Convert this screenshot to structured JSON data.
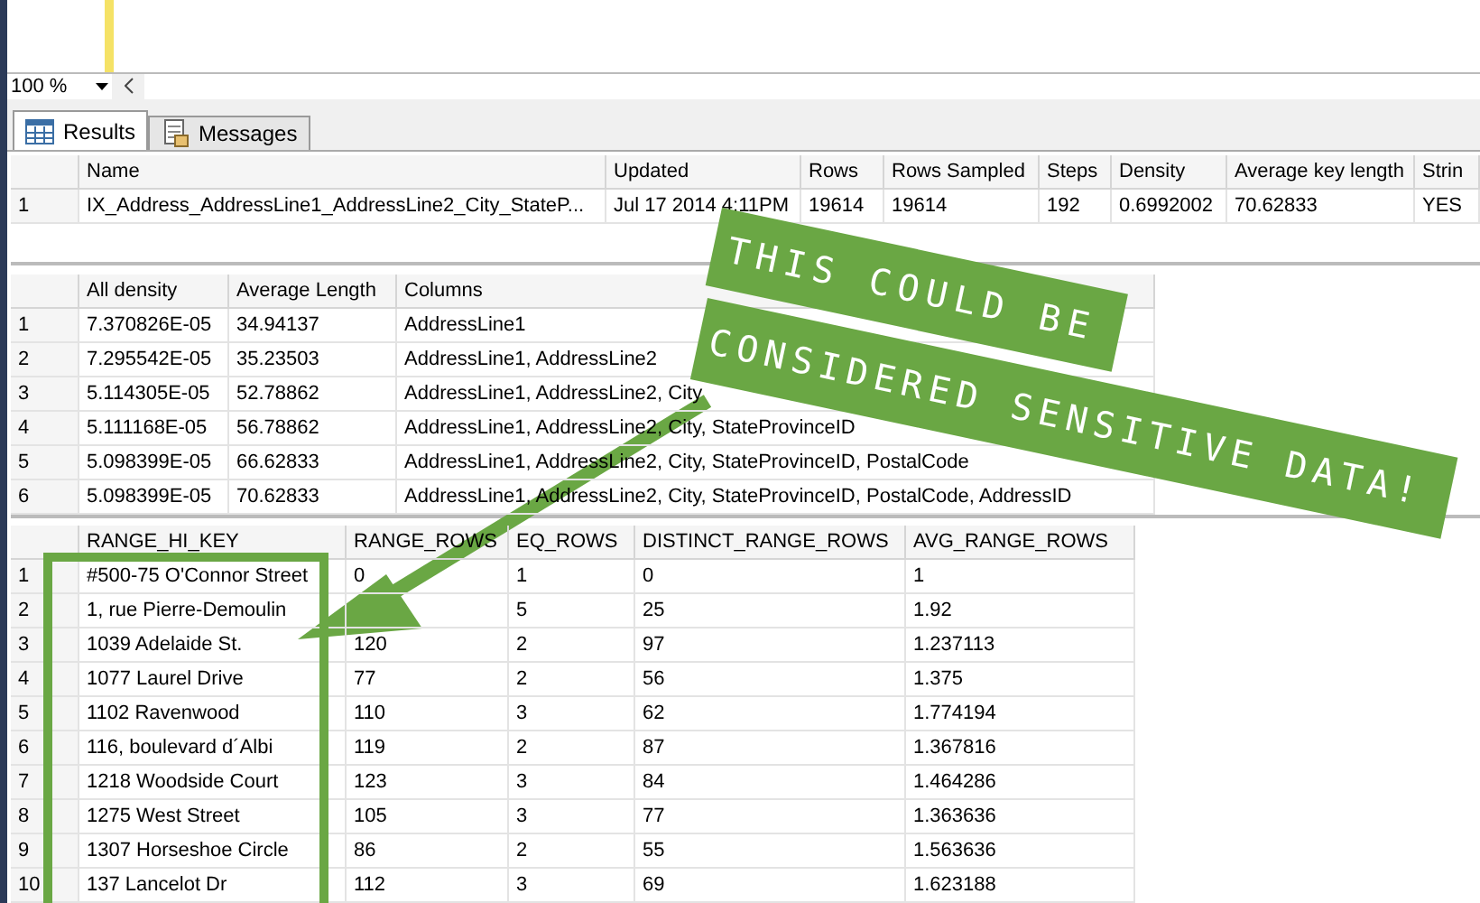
{
  "zoom": {
    "value": "100 %"
  },
  "tabs": [
    {
      "label": "Results",
      "selected": true,
      "kind": "grid"
    },
    {
      "label": "Messages",
      "selected": false,
      "kind": "messages"
    }
  ],
  "grids": [
    {
      "columns": [
        "Name",
        "Updated",
        "Rows",
        "Rows Sampled",
        "Steps",
        "Density",
        "Average key length",
        "Strin"
      ],
      "rows": [
        {
          "number": "1",
          "cells": [
            "IX_Address_AddressLine1_AddressLine2_City_StateP...",
            "Jul 17 2014  4:11PM",
            "19614",
            "19614",
            "192",
            "0.6992002",
            "70.62833",
            "YES"
          ]
        }
      ]
    },
    {
      "columns": [
        "All density",
        "Average Length",
        "Columns"
      ],
      "rows": [
        {
          "number": "1",
          "cells": [
            "7.370826E-05",
            "34.94137",
            "AddressLine1"
          ]
        },
        {
          "number": "2",
          "cells": [
            "7.295542E-05",
            "35.23503",
            "AddressLine1, AddressLine2"
          ]
        },
        {
          "number": "3",
          "cells": [
            "5.114305E-05",
            "52.78862",
            "AddressLine1, AddressLine2, City"
          ]
        },
        {
          "number": "4",
          "cells": [
            "5.111168E-05",
            "56.78862",
            "AddressLine1, AddressLine2, City, StateProvinceID"
          ]
        },
        {
          "number": "5",
          "cells": [
            "5.098399E-05",
            "66.62833",
            "AddressLine1, AddressLine2, City, StateProvinceID, PostalCode"
          ]
        },
        {
          "number": "6",
          "cells": [
            "5.098399E-05",
            "70.62833",
            "AddressLine1, AddressLine2, City, StateProvinceID, PostalCode, AddressID"
          ]
        }
      ]
    },
    {
      "columns": [
        "RANGE_HI_KEY",
        "RANGE_ROWS",
        "EQ_ROWS",
        "DISTINCT_RANGE_ROWS",
        "AVG_RANGE_ROWS"
      ],
      "rows": [
        {
          "number": "1",
          "cells": [
            "#500-75 O'Connor Street",
            "0",
            "1",
            "0",
            "1"
          ]
        },
        {
          "number": "2",
          "cells": [
            "1, rue Pierre-Demoulin",
            "",
            "5",
            "25",
            "1.92"
          ]
        },
        {
          "number": "3",
          "cells": [
            "1039 Adelaide St.",
            "120",
            "2",
            "97",
            "1.237113"
          ]
        },
        {
          "number": "4",
          "cells": [
            "1077 Laurel Drive",
            "77",
            "2",
            "56",
            "1.375"
          ]
        },
        {
          "number": "5",
          "cells": [
            "1102 Ravenwood",
            "110",
            "3",
            "62",
            "1.774194"
          ]
        },
        {
          "number": "6",
          "cells": [
            "116, boulevard d´Albi",
            "119",
            "2",
            "87",
            "1.367816"
          ]
        },
        {
          "number": "7",
          "cells": [
            "1218 Woodside Court",
            "123",
            "3",
            "84",
            "1.464286"
          ]
        },
        {
          "number": "8",
          "cells": [
            "1275 West Street",
            "105",
            "3",
            "77",
            "1.363636"
          ]
        },
        {
          "number": "9",
          "cells": [
            "1307 Horseshoe Circle",
            "86",
            "2",
            "55",
            "1.563636"
          ]
        },
        {
          "number": "10",
          "cells": [
            "137 Lancelot Dr",
            "112",
            "3",
            "69",
            "1.623188"
          ]
        }
      ]
    }
  ],
  "annotation": {
    "lines": [
      "THIS COULD BE",
      "CONSIDERED SENSITIVE DATA!"
    ]
  }
}
